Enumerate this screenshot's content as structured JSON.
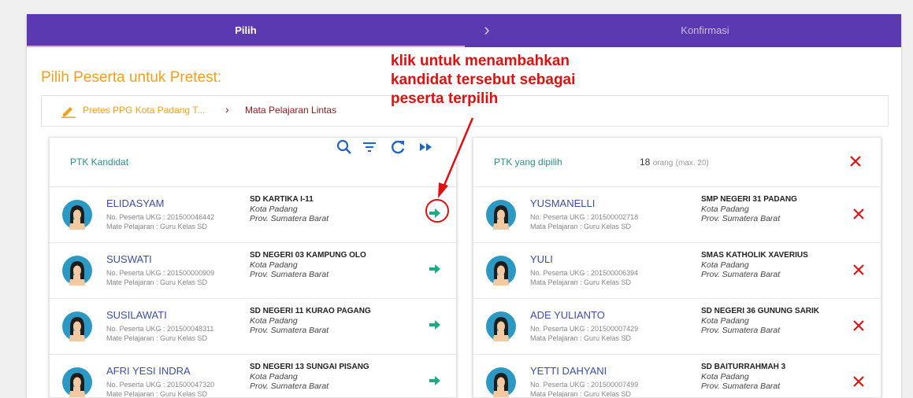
{
  "stepper": {
    "step1": "Pilih",
    "step2": "Konfirmasi",
    "chevron": "›"
  },
  "page": {
    "title": "Pilih Peserta untuk Pretest:"
  },
  "breadcrumb": {
    "item1": "Pretes PPG Kota Padang T...",
    "separator": "›",
    "item2": "Mata Pelajaran Lintas"
  },
  "annotation": {
    "line1": "klik untuk menambahkan",
    "line2": "kandidat tersebut sebagai",
    "line3": "peserta terpilih"
  },
  "left_panel": {
    "title": "PTK Kandidat",
    "tools": [
      "search-icon",
      "filter-icon",
      "refresh-icon",
      "fast-forward-icon"
    ],
    "rows": [
      {
        "name": "ELIDASYAM",
        "no": "No. Peserta UKG : 201500046442",
        "mapel": "Mate Pelajaran : Guru Kelas SD",
        "school": "SD KARTIKA I-11",
        "city": "Kota Padang",
        "prov": "Prov. Sumatera Barat"
      },
      {
        "name": "SUSWATI",
        "no": "No. Peserta UKG : 201500000909",
        "mapel": "Mate Pelajaran : Guru Kelas SD",
        "school": "SD NEGERI 03 KAMPUNG OLO",
        "city": "Kota Padang",
        "prov": "Prov. Sumatera Barat"
      },
      {
        "name": "SUSILAWATI",
        "no": "No. Peserta UKG : 201500048311",
        "mapel": "Mate Pelajaran : Guru Kelas SD",
        "school": "SD NEGERI 11 KURAO PAGANG",
        "city": "Kota Padang",
        "prov": "Prov. Sumatera Barat"
      },
      {
        "name": "AFRI YESI INDRA",
        "no": "No. Peserta UKG : 201500047320",
        "mapel": "Mate Pelajaran : Guru Kelas SD",
        "school": "SD NEGERI 13 SUNGAI PISANG",
        "city": "Kota Padang",
        "prov": "Prov. Sumatera Barat"
      }
    ]
  },
  "right_panel": {
    "title": "PTK yang dipilih",
    "count": "18",
    "count_unit": "orang",
    "count_max": "(max. 20)",
    "rows": [
      {
        "name": "YUSMANELLI",
        "no": "No. Peserta UKG : 201500002718",
        "mapel": "Mata Pelajaran : Guru Kelas SD",
        "school": "SMP NEGERI 31 PADANG",
        "city": "Kota Padang",
        "prov": "Prov. Sumatera Barat"
      },
      {
        "name": "YULI",
        "no": "No. Peserta UKG : 201500006394",
        "mapel": "Mata Pelajaran : Guru Kelas SD",
        "school": "SMAS KATHOLIK XAVERIUS",
        "city": "Kota Padang",
        "prov": "Prov. Sumatera Barat"
      },
      {
        "name": "ADE YULIANTO",
        "no": "No. Peserta UKG : 201500007429",
        "mapel": "Mata Pelajaran : Guru Kelas SD",
        "school": "SD NEGERI 36 GUNUNG SARIK",
        "city": "Kota Padang",
        "prov": "Prov. Sumatera Barat"
      },
      {
        "name": "YETTI DAHYANI",
        "no": "No. Peserta UKG : 201500007499",
        "mapel": "Mata Pelajaran : Guru Kelas SD",
        "school": "SD BAITURRAHMAH 3",
        "city": "Kota Padang",
        "prov": "Prov. Sumatera Barat"
      }
    ]
  },
  "colors": {
    "header": "#5b39b0",
    "accent_orange": "#f0a020",
    "teal": "#2a8f8a",
    "red": "#e01010",
    "name_blue": "#3d4fa0"
  }
}
